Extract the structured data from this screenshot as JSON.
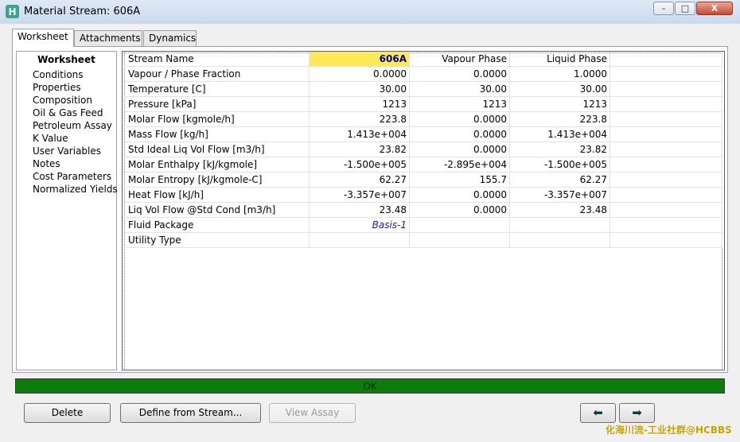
{
  "window": {
    "title": "Material Stream: 606A",
    "icon_letter": "H",
    "minimize": "–",
    "maximize": "□",
    "close": "X"
  },
  "tabs": [
    {
      "label": "Worksheet",
      "active": true
    },
    {
      "label": "Attachments",
      "active": false
    },
    {
      "label": "Dynamics",
      "active": false
    }
  ],
  "nav": {
    "header": "Worksheet",
    "items": [
      "Conditions",
      "Properties",
      "Composition",
      "Oil & Gas Feed",
      "Petroleum Assay",
      "K Value",
      "User Variables",
      "Notes",
      "Cost Parameters",
      "Normalized Yields"
    ]
  },
  "grid": {
    "columns": [
      "Stream Name",
      "606A",
      "Vapour Phase",
      "Liquid Phase"
    ],
    "rows": [
      [
        "Vapour / Phase Fraction",
        "0.0000",
        "0.0000",
        "1.0000"
      ],
      [
        "Temperature [C]",
        "30.00",
        "30.00",
        "30.00"
      ],
      [
        "Pressure [kPa]",
        "1213",
        "1213",
        "1213"
      ],
      [
        "Molar Flow [kgmole/h]",
        "223.8",
        "0.0000",
        "223.8"
      ],
      [
        "Mass Flow [kg/h]",
        "1.413e+004",
        "0.0000",
        "1.413e+004"
      ],
      [
        "Std Ideal Liq Vol Flow [m3/h]",
        "23.82",
        "0.0000",
        "23.82"
      ],
      [
        "Molar Enthalpy [kJ/kgmole]",
        "-1.500e+005",
        "-2.895e+004",
        "-1.500e+005"
      ],
      [
        "Molar Entropy [kJ/kgmole-C]",
        "62.27",
        "155.7",
        "62.27"
      ],
      [
        "Heat Flow [kJ/h]",
        "-3.357e+007",
        "0.0000",
        "-3.357e+007"
      ],
      [
        "Liq Vol Flow @Std Cond [m3/h]",
        "23.48",
        "0.0000",
        "23.48"
      ],
      [
        "Fluid Package",
        "Basis-1",
        "",
        ""
      ],
      [
        "Utility Type",
        "",
        "",
        ""
      ]
    ]
  },
  "status": {
    "text": "OK",
    "color": "#0a7d0a"
  },
  "buttons": {
    "delete": "Delete",
    "define_from_stream": "Define from Stream...",
    "view_assay": "View Assay",
    "prev_arrow": "⬅",
    "next_arrow": "➡"
  },
  "watermark": "化海川流-工业社群@HCBBS"
}
